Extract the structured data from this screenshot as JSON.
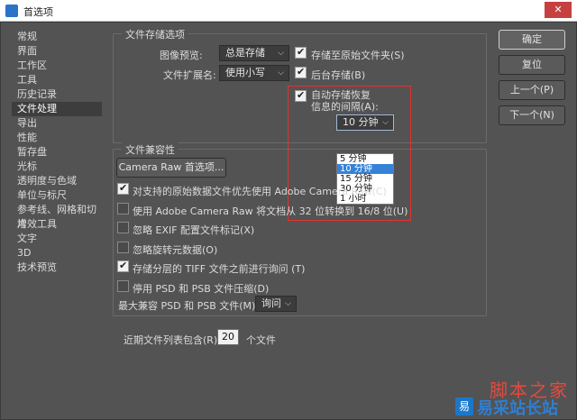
{
  "window": {
    "title": "首选项",
    "close_symbol": "✕"
  },
  "sidebar": {
    "items": [
      "常规",
      "界面",
      "工作区",
      "工具",
      "历史记录",
      "文件处理",
      "导出",
      "性能",
      "暂存盘",
      "光标",
      "透明度与色域",
      "单位与标尺",
      "参考线、网格和切片",
      "增效工具",
      "文字",
      "3D",
      "技术预览"
    ],
    "active_index": 5
  },
  "file_save": {
    "group_title": "文件存储选项",
    "image_preview_label": "图像预览:",
    "image_preview_value": "总是存储",
    "file_ext_label": "文件扩展名:",
    "file_ext_value": "使用小写",
    "save_to_original": "存储至原始文件夹(S)",
    "background_save": "后台存储(B)",
    "auto_recover_line1": "自动存储恢复",
    "auto_recover_line2": "信息的间隔(A):",
    "interval_value": "10 分钟",
    "interval_options": [
      "5 分钟",
      "10 分钟",
      "15 分钟",
      "30 分钟",
      "1 小时"
    ],
    "interval_selected_index": 1
  },
  "compat": {
    "group_title": "文件兼容性",
    "camera_raw_button": "Camera Raw 首选项...",
    "options": [
      {
        "label": "对支持的原始数据文件优先使用 Adobe Camera Raw(C)",
        "checked": true
      },
      {
        "label": "使用 Adobe Camera Raw 将文档从 32 位转换到 16/8 位(U)",
        "checked": false
      },
      {
        "label": "忽略 EXIF 配置文件标记(X)",
        "checked": false
      },
      {
        "label": "忽略旋转元数据(O)",
        "checked": false
      },
      {
        "label": "存储分层的 TIFF 文件之前进行询问 (T)",
        "checked": true
      },
      {
        "label": "停用 PSD 和 PSB 文件压缩(D)",
        "checked": false
      }
    ],
    "max_compat_label": "最大兼容 PSD 和 PSB 文件(M):",
    "max_compat_value": "询问"
  },
  "recent": {
    "label": "近期文件列表包含(R):",
    "value": "20",
    "suffix": "个文件"
  },
  "buttons": {
    "ok": "确定",
    "reset": "复位",
    "prev": "上一个(P)",
    "next": "下一个(N)"
  },
  "watermark": {
    "top": "脚本之家",
    "bottom": "易采站长站",
    "logo": "易"
  }
}
